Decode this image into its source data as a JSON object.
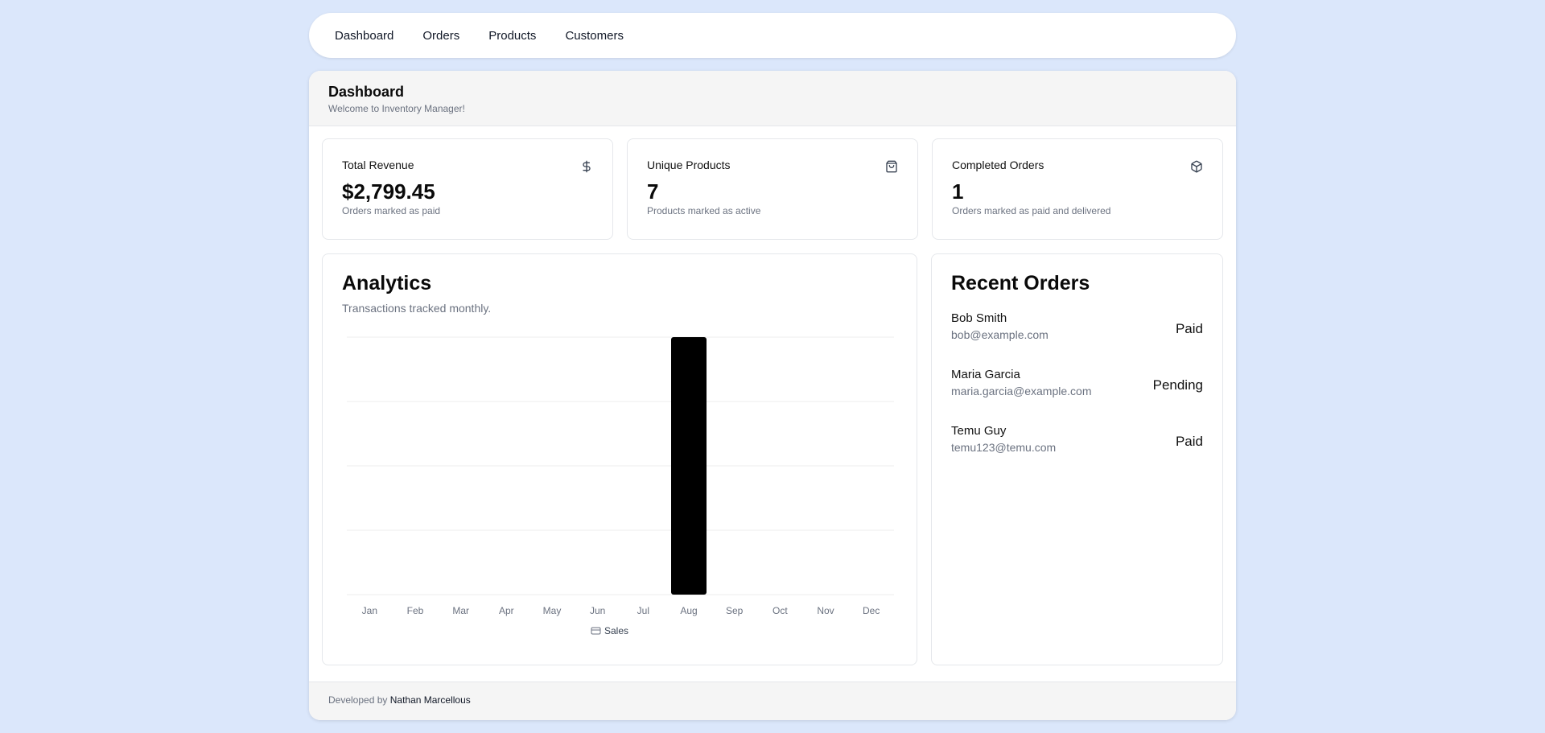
{
  "nav": {
    "items": [
      "Dashboard",
      "Orders",
      "Products",
      "Customers"
    ]
  },
  "header": {
    "title": "Dashboard",
    "subtitle": "Welcome to Inventory Manager!"
  },
  "stats": [
    {
      "title": "Total Revenue",
      "value": "$2,799.45",
      "sub": "Orders marked as paid",
      "icon": "dollar-icon"
    },
    {
      "title": "Unique Products",
      "value": "7",
      "sub": "Products marked as active",
      "icon": "shopping-bag-icon"
    },
    {
      "title": "Completed Orders",
      "value": "1",
      "sub": "Orders marked as paid and delivered",
      "icon": "package-icon"
    }
  ],
  "analytics": {
    "title": "Analytics",
    "subtitle": "Transactions tracked monthly."
  },
  "chart_data": {
    "type": "bar",
    "categories": [
      "Jan",
      "Feb",
      "Mar",
      "Apr",
      "May",
      "Jun",
      "Jul",
      "Aug",
      "Sep",
      "Oct",
      "Nov",
      "Dec"
    ],
    "series": [
      {
        "name": "Sales",
        "values": [
          0,
          0,
          0,
          0,
          0,
          0,
          0,
          1,
          0,
          0,
          0,
          0
        ]
      }
    ],
    "ylim": [
      0,
      1
    ],
    "grid": true,
    "legend": "bottom-center",
    "bar_color": "#000000"
  },
  "recent": {
    "title": "Recent Orders",
    "orders": [
      {
        "name": "Bob Smith",
        "email": "bob@example.com",
        "status": "Paid"
      },
      {
        "name": "Maria Garcia",
        "email": "maria.garcia@example.com",
        "status": "Pending"
      },
      {
        "name": "Temu Guy",
        "email": "temu123@temu.com",
        "status": "Paid"
      }
    ]
  },
  "footer": {
    "prefix": "Developed by",
    "author": "Nathan Marcellous"
  },
  "colors": {
    "background": "#dbe7fb",
    "muted_text": "#6b7280",
    "border": "#e5e7eb"
  }
}
